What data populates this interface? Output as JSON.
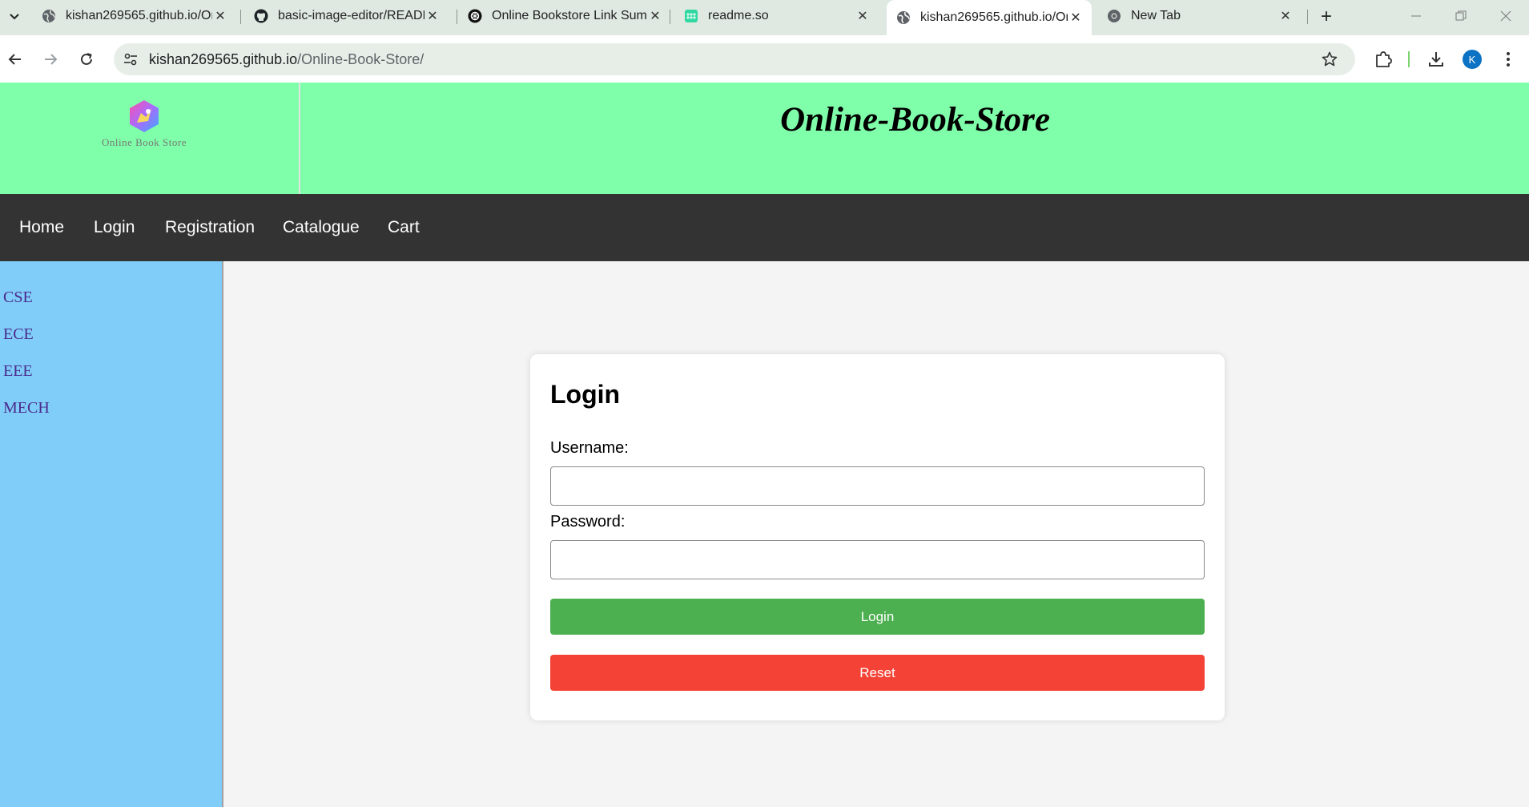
{
  "browser": {
    "tabs": [
      {
        "title": "kishan269565.github.io/On",
        "favicon": "globe-icon",
        "active": false
      },
      {
        "title": "basic-image-editor/READM",
        "favicon": "github-icon",
        "active": false
      },
      {
        "title": "Online Bookstore Link Sum",
        "favicon": "openai-icon",
        "active": false
      },
      {
        "title": "readme.so",
        "favicon": "readme-icon",
        "active": false
      },
      {
        "title": "kishan269565.github.io/On",
        "favicon": "globe-icon",
        "active": true
      },
      {
        "title": "New Tab",
        "favicon": "chrome-icon",
        "active": false
      }
    ],
    "url_host": "kishan269565.github.io",
    "url_path": "/Online-Book-Store/",
    "profile_initial": "K",
    "colors": {
      "tabstrip": "#dfe8e1",
      "omnibox": "#e7eee8",
      "profile": "#0b72c4"
    }
  },
  "site": {
    "logo_text": "Online Book Store",
    "title": "Online-Book-Store",
    "colors": {
      "header": "#80ffaa",
      "nav": "#333333",
      "sidebar": "#7fcdf8",
      "sidebar_link": "#4b2a8c"
    }
  },
  "nav": {
    "items": [
      "Home",
      "Login",
      "Registration",
      "Catalogue",
      "Cart"
    ]
  },
  "sidebar": {
    "items": [
      "CSE",
      "ECE",
      "EEE",
      "MECH"
    ]
  },
  "login_form": {
    "heading": "Login",
    "username_label": "Username:",
    "username_value": "",
    "password_label": "Password:",
    "password_value": "",
    "login_button": "Login",
    "reset_button": "Reset",
    "colors": {
      "login": "#4caf50",
      "reset": "#f44336"
    }
  }
}
